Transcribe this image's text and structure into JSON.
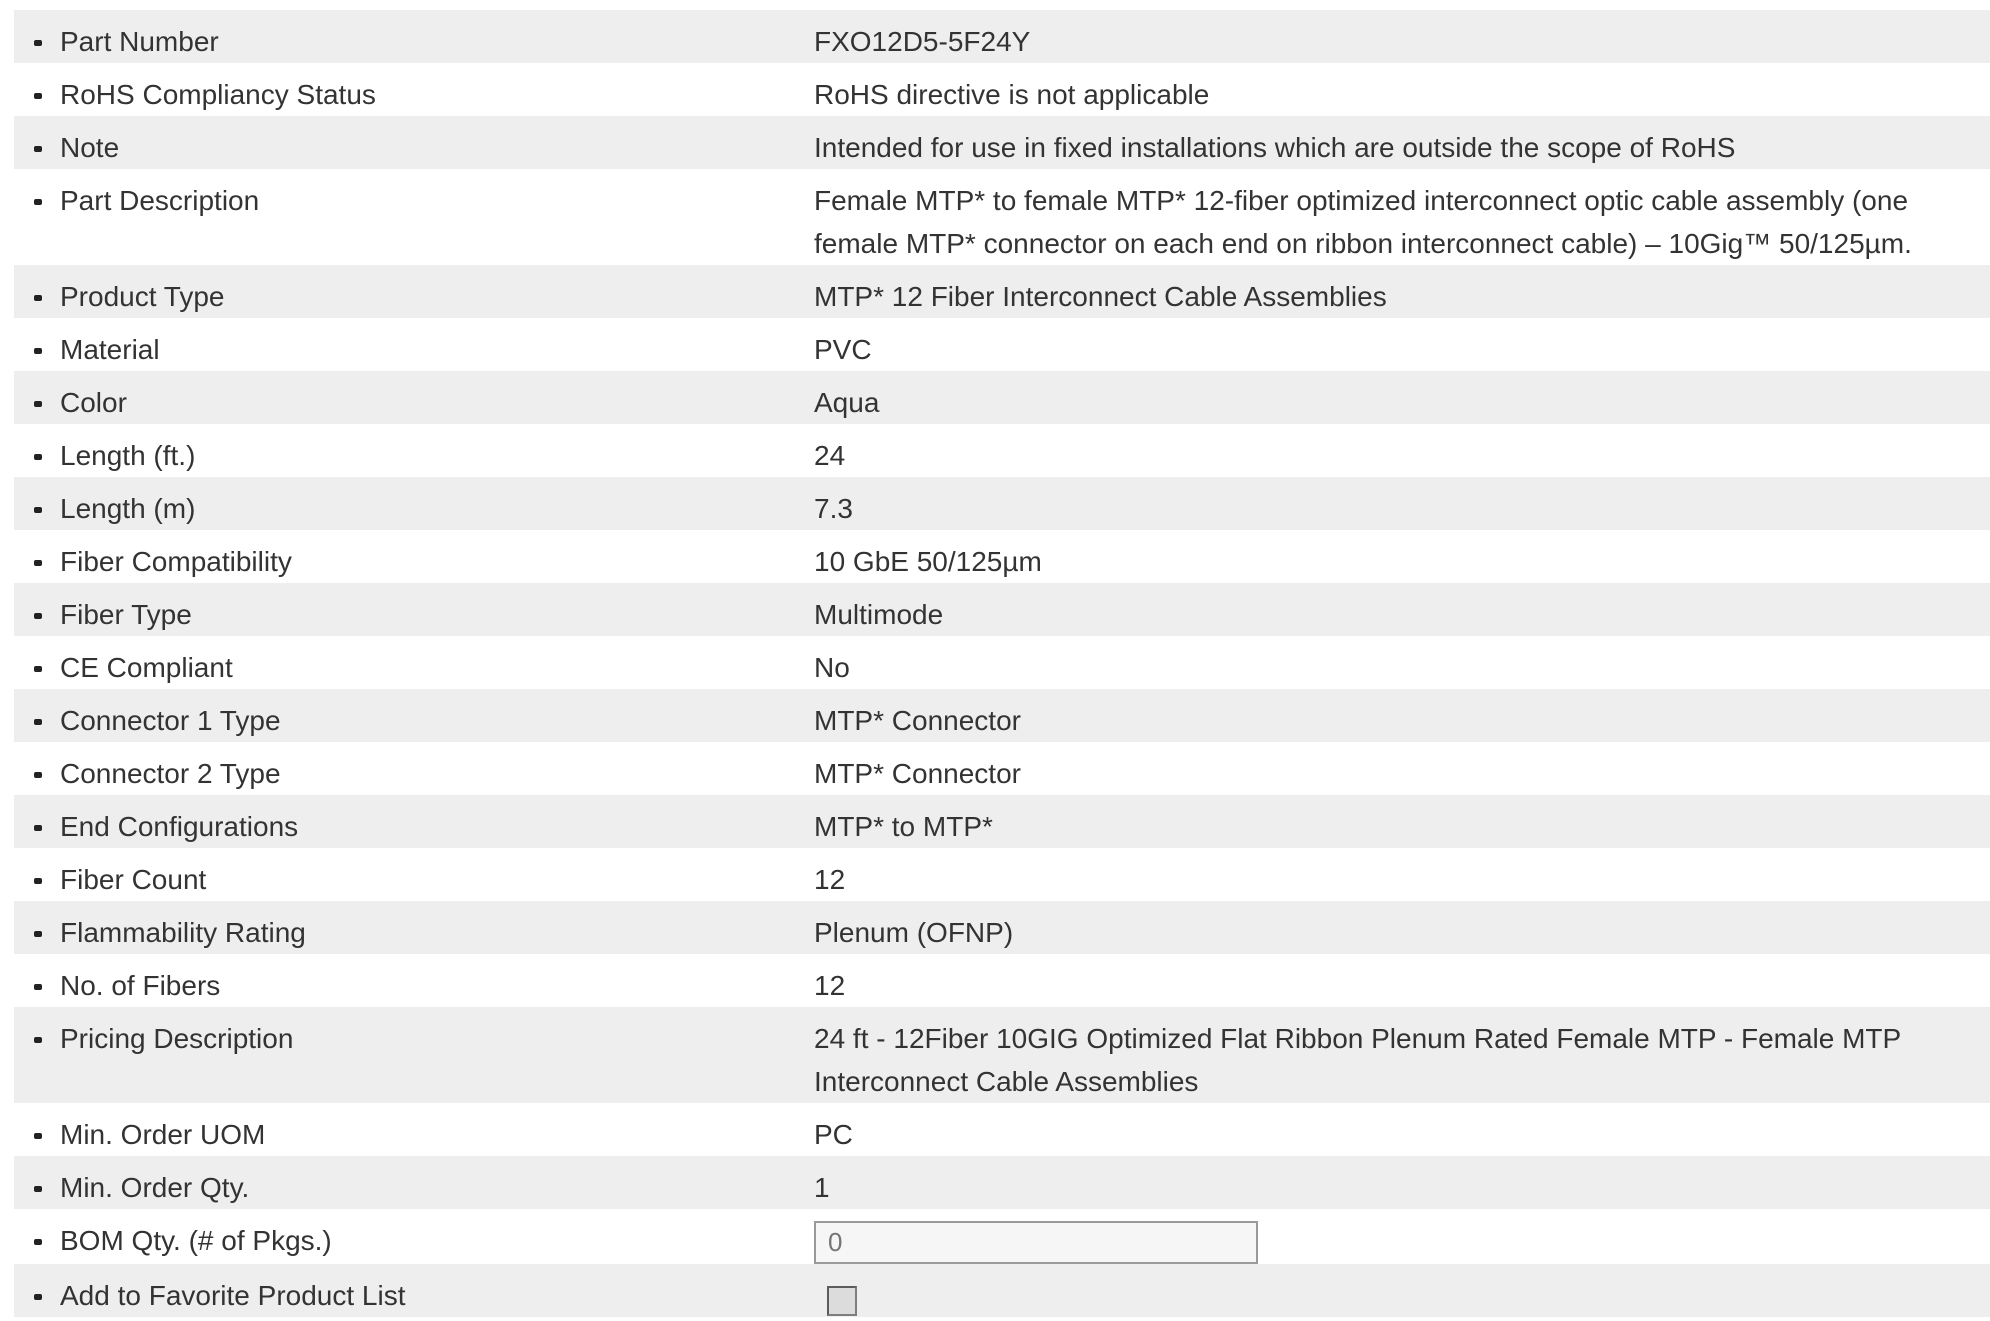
{
  "rows": [
    {
      "label": "Part Number",
      "value": "FXO12D5-5F24Y"
    },
    {
      "label": "RoHS Compliancy Status",
      "value": "RoHS directive is not applicable"
    },
    {
      "label": "Note",
      "value": "Intended for use in fixed installations which are outside the scope of RoHS"
    },
    {
      "label": "Part Description",
      "value": "Female MTP* to female MTP* 12-fiber optimized interconnect optic cable assembly (one female MTP* connector on each end on ribbon interconnect cable) – 10Gig™ 50/125µm."
    },
    {
      "label": "Product Type",
      "value": "MTP* 12 Fiber Interconnect Cable Assemblies"
    },
    {
      "label": "Material",
      "value": "PVC"
    },
    {
      "label": "Color",
      "value": "Aqua"
    },
    {
      "label": "Length (ft.)",
      "value": "24"
    },
    {
      "label": "Length (m)",
      "value": "7.3"
    },
    {
      "label": "Fiber Compatibility",
      "value": "10 GbE 50/125µm"
    },
    {
      "label": "Fiber Type",
      "value": "Multimode"
    },
    {
      "label": "CE Compliant",
      "value": "No"
    },
    {
      "label": "Connector 1 Type",
      "value": "MTP* Connector"
    },
    {
      "label": "Connector 2 Type",
      "value": "MTP* Connector"
    },
    {
      "label": "End Configurations",
      "value": "MTP* to MTP*"
    },
    {
      "label": "Fiber Count",
      "value": "12"
    },
    {
      "label": "Flammability Rating",
      "value": "Plenum (OFNP)"
    },
    {
      "label": "No. of Fibers",
      "value": "12"
    },
    {
      "label": "Pricing Description",
      "value": "24 ft - 12Fiber 10GIG Optimized Flat Ribbon Plenum Rated Female MTP - Female MTP Interconnect Cable Assemblies"
    },
    {
      "label": "Min. Order UOM",
      "value": "PC"
    },
    {
      "label": "Min. Order Qty.",
      "value": "1"
    }
  ],
  "bom_qty": {
    "label": "BOM Qty. (# of Pkgs.)",
    "placeholder": "0"
  },
  "favorite": {
    "label": "Add to Favorite Product List",
    "checked": false
  },
  "colors": {
    "row_alt": "#eeeeee",
    "text": "#333333"
  }
}
